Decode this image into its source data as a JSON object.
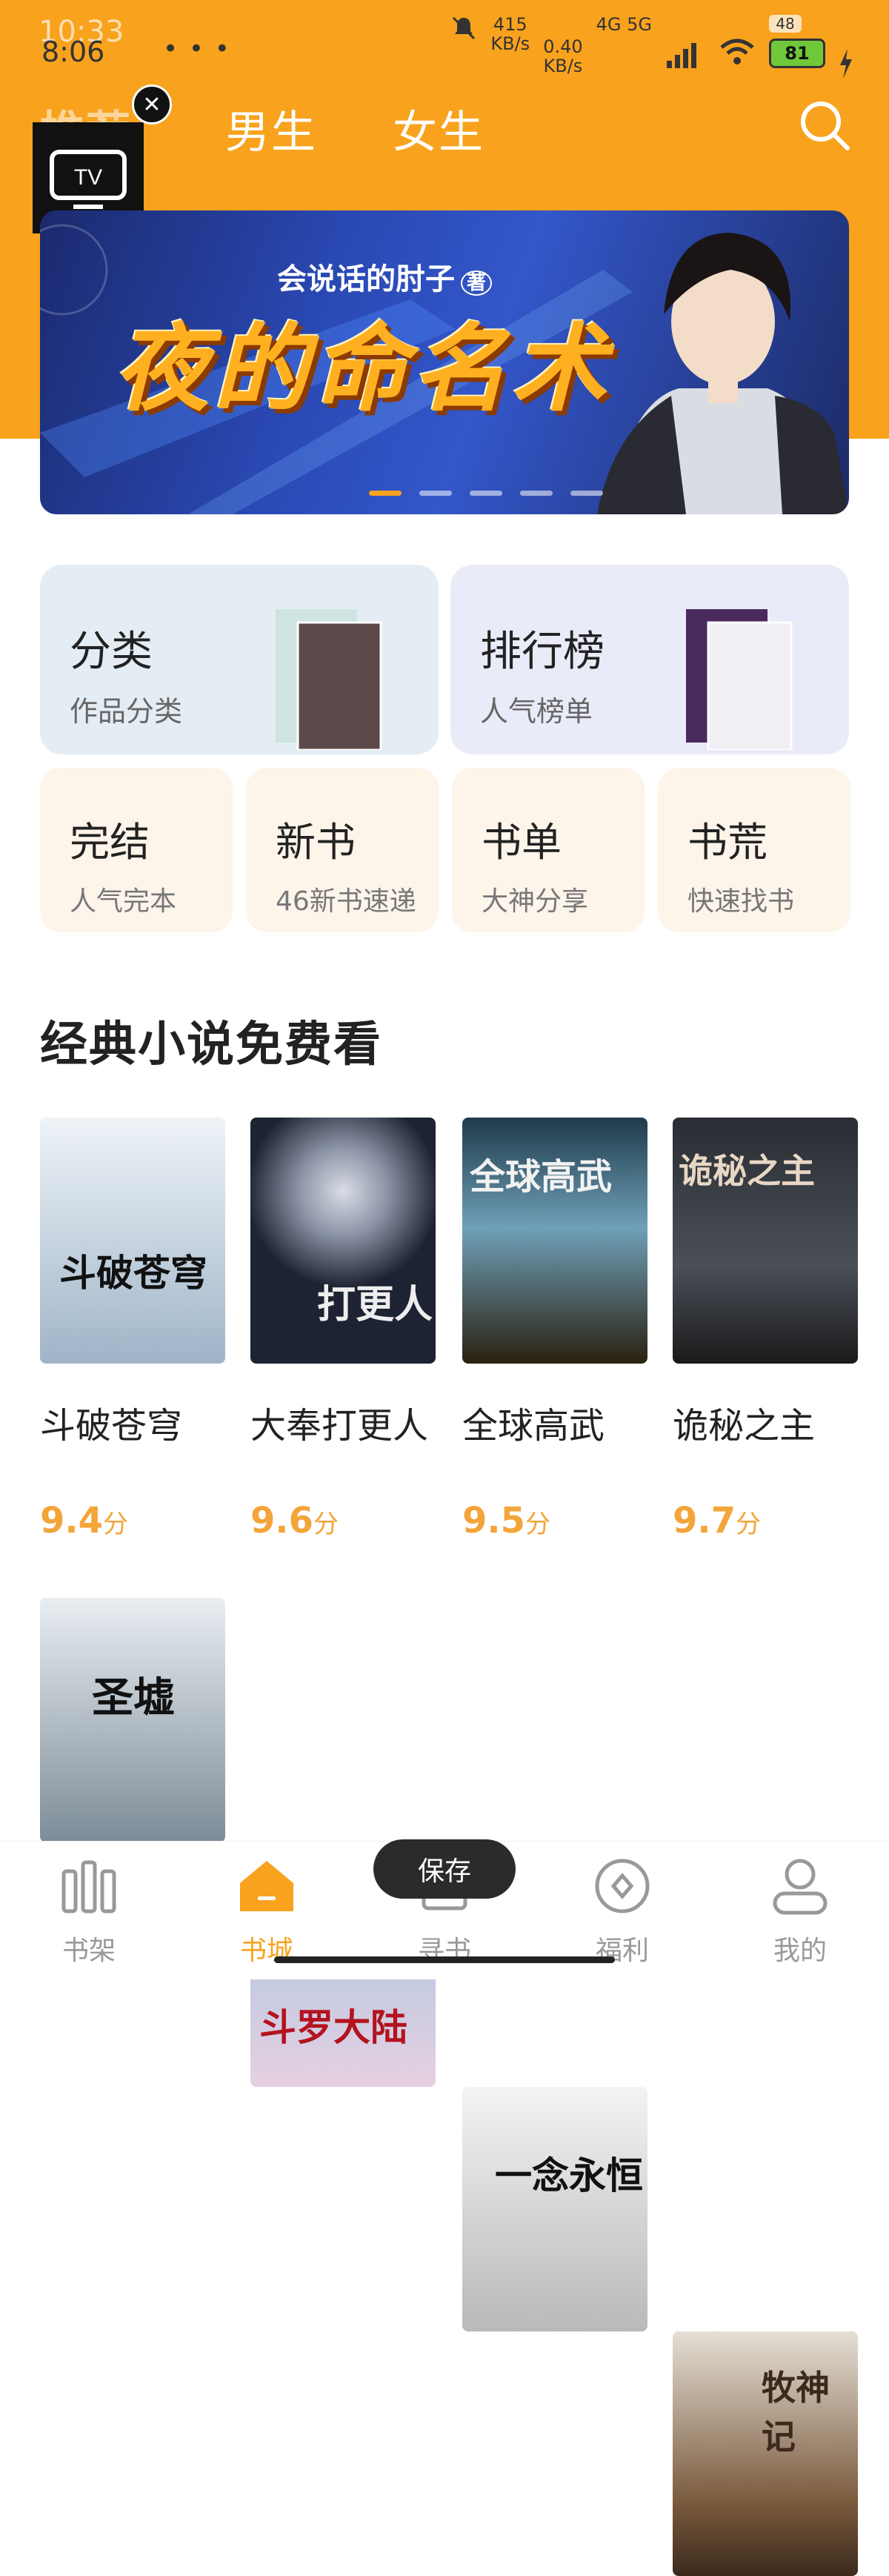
{
  "status": {
    "time_back": "10:33",
    "time": "8:06",
    "dots": "• • •",
    "speed_top": "415",
    "speed_top_unit": "KB/s",
    "speed": "0.40",
    "speed_unit": "KB/s",
    "net": "4G 5G",
    "battery": "81",
    "battery_back": "48"
  },
  "tabs": [
    "推荐",
    "男生",
    "女生"
  ],
  "banner": {
    "author": "会说话的肘子",
    "author_suffix": "著",
    "title": "夜的命名术"
  },
  "categories_big": [
    {
      "title": "分类",
      "sub": "作品分类"
    },
    {
      "title": "排行榜",
      "sub": "人气榜单"
    }
  ],
  "categories_small": [
    {
      "title": "完结",
      "sub": "人气完本"
    },
    {
      "title": "新书",
      "sub": "46新书速递"
    },
    {
      "title": "书单",
      "sub": "大神分享"
    },
    {
      "title": "书荒",
      "sub": "快速找书"
    }
  ],
  "section_title": "经典小说免费看",
  "books": [
    {
      "name": "斗破苍穹",
      "score": "9.4",
      "unit": "分",
      "cover_text": "斗破苍穹"
    },
    {
      "name": "大奉打更人",
      "score": "9.6",
      "unit": "分",
      "cover_text": "打更人"
    },
    {
      "name": "全球高武",
      "score": "9.5",
      "unit": "分",
      "cover_text": "全球高武"
    },
    {
      "name": "诡秘之主",
      "score": "9.7",
      "unit": "分",
      "cover_text": "诡秘之主"
    }
  ],
  "books_row2": [
    {
      "cover_text": "圣墟"
    },
    {
      "cover_text": "斗罗大陆"
    },
    {
      "cover_text": "一念永恒"
    },
    {
      "cover_text": "牧神记"
    }
  ],
  "nav": [
    "书架",
    "书城",
    "寻书",
    "福利",
    "我的"
  ],
  "toast": "保存",
  "colors": {
    "brand": "#F8A21D",
    "score": "#F3A53A"
  }
}
